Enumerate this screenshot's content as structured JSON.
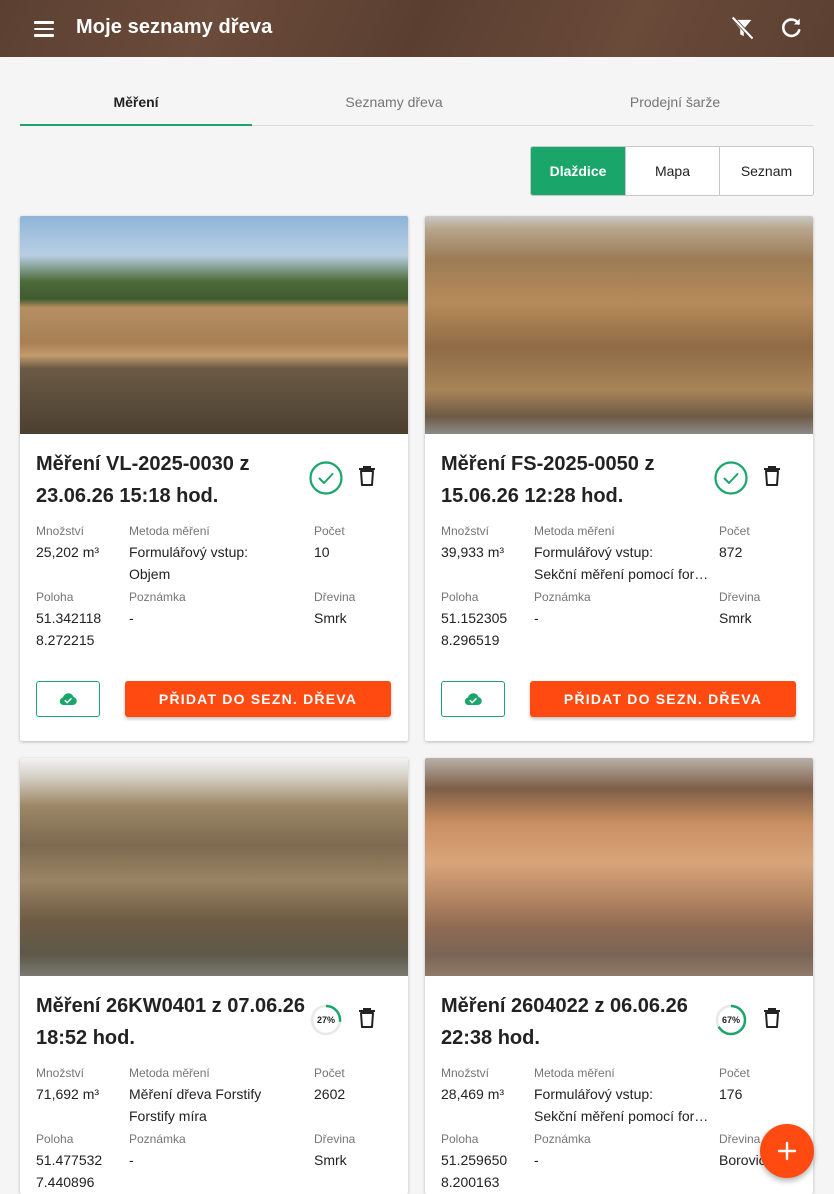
{
  "app_title": "Moje seznamy dřeva",
  "icons": {
    "menu": "menu-icon",
    "filter_off": "filter-off-icon",
    "refresh": "refresh-icon",
    "check": "check-circle-icon",
    "trash": "trash-icon",
    "cloud": "cloud-done-icon",
    "add": "plus-icon"
  },
  "colors": {
    "accent": "#1aa66a",
    "action": "#ff4a12",
    "appbar": "#5b4032"
  },
  "tabs": [
    {
      "label": "Měření",
      "active": true
    },
    {
      "label": "Seznamy dřeva",
      "active": false
    },
    {
      "label": "Prodejní šarže",
      "active": false
    }
  ],
  "view_toggle": {
    "options": [
      "Dlaždice",
      "Mapa",
      "Seznam"
    ],
    "selected": "Dlaždice"
  },
  "labels": {
    "amount": "Množství",
    "method": "Metoda měření",
    "count": "Počet",
    "location": "Poloha",
    "note": "Poznámka",
    "species": "Dřevina",
    "add_button": "PŘIDAT DO SEZN. DŘEVA"
  },
  "cards": [
    {
      "title": "Měření VL-2025-0030 z 23.06.26 15:18 hod.",
      "status": "done",
      "amount": "25,202 m³",
      "method_line1": "Formulářový vstup:",
      "method_line2": "Objem",
      "count": "10",
      "lat": "51.342118",
      "lon": "8.272215",
      "note": "-",
      "species": "Smrk"
    },
    {
      "title": "Měření FS-2025-0050 z 15.06.26 12:28 hod.",
      "status": "done",
      "amount": "39,933 m³",
      "method_line1": "Formulářový vstup:",
      "method_line2": "Sekční měření pomocí for…",
      "count": "872",
      "lat": "51.152305",
      "lon": "8.296519",
      "note": "-",
      "species": "Smrk"
    },
    {
      "title": "Měření 26KW0401 z 07.06.26 18:52 hod.",
      "status": "progress",
      "progress_text": "27%",
      "progress": 0.27,
      "amount": "71,692 m³",
      "method_line1": "Měření dřeva Forstify",
      "method_line2": "Forstify míra",
      "count": "2602",
      "lat": "51.477532",
      "lon": "7.440896",
      "note": "-",
      "species": "Smrk"
    },
    {
      "title": "Měření 2604022 z 06.06.26 22:38 hod.",
      "status": "progress",
      "progress_text": "67%",
      "progress": 0.67,
      "amount": "28,469 m³",
      "method_line1": "Formulářový vstup:",
      "method_line2": "Sekční měření pomocí for…",
      "count": "176",
      "lat": "51.259650",
      "lon": "8.200163",
      "note": "-",
      "species": "Borovice"
    }
  ]
}
